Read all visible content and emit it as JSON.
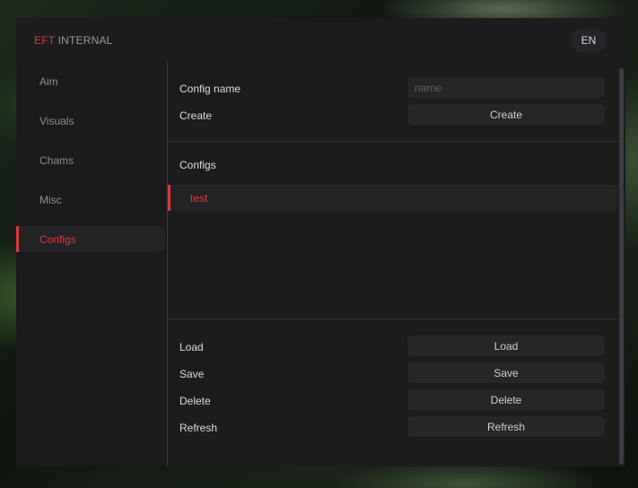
{
  "app": {
    "brand_accent": "EFT",
    "brand_rest": " INTERNAL",
    "language": "EN",
    "accent_color": "#e0383c"
  },
  "sidebar": {
    "items": [
      {
        "label": "Aim"
      },
      {
        "label": "Visuals"
      },
      {
        "label": "Chams"
      },
      {
        "label": "Misc"
      },
      {
        "label": "Configs",
        "active": true
      }
    ]
  },
  "config": {
    "name_label": "Config name",
    "name_placeholder": "name",
    "name_value": "",
    "create_label": "Create",
    "create_button": "Create",
    "list_title": "Configs",
    "list_items": [
      "test"
    ],
    "actions": [
      {
        "label": "Load",
        "button": "Load"
      },
      {
        "label": "Save",
        "button": "Save"
      },
      {
        "label": "Delete",
        "button": "Delete"
      },
      {
        "label": "Refresh",
        "button": "Refresh"
      }
    ]
  }
}
